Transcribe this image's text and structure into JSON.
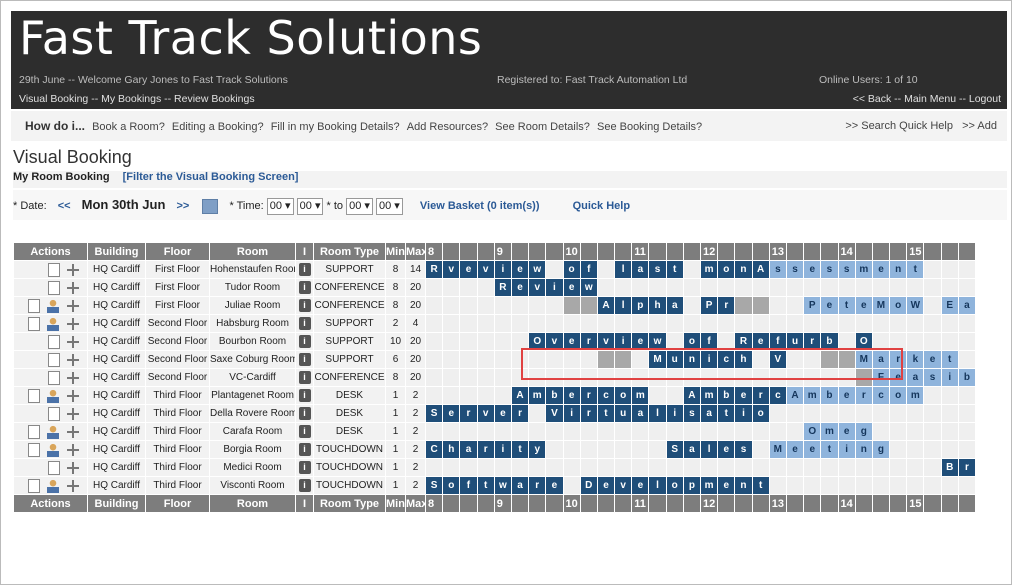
{
  "header": {
    "brand": "Fast Track Solutions",
    "welcome": "29th June -- Welcome Gary Jones to Fast Track Solutions",
    "registered": "Registered to: Fast Track Automation Ltd",
    "online": "Online Users: 1 of 10",
    "nav_left": [
      "Visual Booking",
      "My Bookings",
      "Review Bookings"
    ],
    "nav_right": [
      "<< Back",
      "Main Menu",
      "Logout"
    ]
  },
  "howdo": {
    "title": "How do i...",
    "links": [
      "Book a Room?",
      "Editing a Booking?",
      "Fill in my Booking Details?",
      "Add Resources?",
      "See Room Details?",
      "See Booking Details?"
    ],
    "right": [
      ">> Search Quick Help",
      ">> Add"
    ]
  },
  "page": {
    "title": "Visual Booking",
    "my_room": "My Room Booking",
    "filter": "[Filter the Visual Booking Screen]"
  },
  "datebar": {
    "date_label": "* Date:",
    "prev": "<<",
    "date": "Mon 30th Jun",
    "next": ">>",
    "time_label": "* Time:",
    "from_h": "00",
    "from_m": "00",
    "to_label": "* to",
    "to_h": "00",
    "to_m": "00",
    "basket": "View Basket (0 item(s))",
    "quick_help": "Quick Help"
  },
  "table": {
    "headers": [
      "Actions",
      "Building",
      "Floor",
      "Room",
      "I",
      "Room Type",
      "Min",
      "Max"
    ],
    "hours": [
      "8",
      "9",
      "10",
      "11",
      "12",
      "13",
      "14",
      "15"
    ],
    "rows": [
      {
        "building": "HQ Cardiff",
        "floor": "First Floor",
        "room": "Hohenstaufen Room",
        "type": "SUPPORT",
        "min": "8",
        "max": "14",
        "user": false
      },
      {
        "building": "HQ Cardiff",
        "floor": "First Floor",
        "room": "Tudor Room",
        "type": "CONFERENCE",
        "min": "8",
        "max": "20",
        "user": false
      },
      {
        "building": "HQ Cardiff",
        "floor": "First Floor",
        "room": "Juliae Room",
        "type": "CONFERENCE",
        "min": "8",
        "max": "20",
        "user": true
      },
      {
        "building": "HQ Cardiff",
        "floor": "Second Floor",
        "room": "Habsburg Room",
        "type": "SUPPORT",
        "min": "2",
        "max": "4",
        "user": true
      },
      {
        "building": "HQ Cardiff",
        "floor": "Second Floor",
        "room": "Bourbon Room",
        "type": "SUPPORT",
        "min": "10",
        "max": "20",
        "user": false
      },
      {
        "building": "HQ Cardiff",
        "floor": "Second Floor",
        "room": "Saxe Coburg Room",
        "type": "SUPPORT",
        "min": "6",
        "max": "20",
        "user": false
      },
      {
        "building": "HQ Cardiff",
        "floor": "Second Floor",
        "room": "VC-Cardiff",
        "type": "CONFERENCE",
        "min": "8",
        "max": "20",
        "user": false
      },
      {
        "building": "HQ Cardiff",
        "floor": "Third Floor",
        "room": "Plantagenet Room",
        "type": "DESK",
        "min": "1",
        "max": "2",
        "user": true
      },
      {
        "building": "HQ Cardiff",
        "floor": "Third Floor",
        "room": "Della Rovere Room",
        "type": "DESK",
        "min": "1",
        "max": "2",
        "user": false
      },
      {
        "building": "HQ Cardiff",
        "floor": "Third Floor",
        "room": "Carafa Room",
        "type": "DESK",
        "min": "1",
        "max": "2",
        "user": true
      },
      {
        "building": "HQ Cardiff",
        "floor": "Third Floor",
        "room": "Borgia Room",
        "type": "TOUCHDOWN",
        "min": "1",
        "max": "2",
        "user": true
      },
      {
        "building": "HQ Cardiff",
        "floor": "Third Floor",
        "room": "Medici Room",
        "type": "TOUCHDOWN",
        "min": "1",
        "max": "2",
        "user": false
      },
      {
        "building": "HQ Cardiff",
        "floor": "Third Floor",
        "room": "Visconti Room",
        "type": "TOUCHDOWN",
        "min": "1",
        "max": "2",
        "user": true
      }
    ],
    "slots": [
      "dR dv de dv di de dw e do df e dl da ds dt e dm do dn dA ls ls le ls ls lm le ln lt e e e l",
      "e e e e dR de dv di de dw e e e e e e e e e e e e e e e e e e e e e e",
      "e e e e e e e e g g dA dl dp dh da e dP dr g g e e lP le lt le lM lo lW e lE la l",
      "e e e e e e e e e e e e e e e e e e e e e e e e e e e e e e e e",
      "e e e e e e dO dv de dr dv di de dw e do df e dR de df du dr db e dO e e e e e e e",
      "e e e e e e e e e e g g e dM du dn di dc dh e dV e e g g lM la lr lk le lt e",
      "e e e e e e e e e e e e e e e e e e e e e e e e e g lF le la ls li lb e",
      "e e e e e dA dm db de dr dc do dm e e dA dm db de dr dc lA lm lb le lr lc lo lm e e e e",
      "dS de dr dv de dr e dV di dr dt du da dl di ds da dt di do e e e e e e e e e e e e",
      "e e e e e e e e e e e e e e e e e e e e e e lO lm le lg e e e e e e e e",
      "dC dh da dr di dt dy e e e e e e e dS da dl de ds e lM le le lt li ln lg e e e e e e",
      "e e e e e e e e e e e e e e e e e e e e e e e e e e e e e e dB dr",
      "dS do df dt dw da dr de e dD de dv de dl do dp dm de dn dt e e e e e e e e e e e e"
    ]
  }
}
